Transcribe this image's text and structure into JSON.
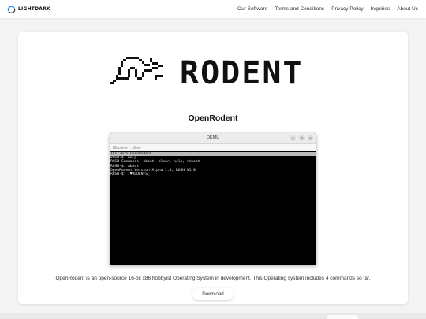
{
  "nav": {
    "brand": "LIGHTDARK",
    "links": [
      {
        "label": "Our Software"
      },
      {
        "label": "Terms and Conditions"
      },
      {
        "label": "Privacy Policy"
      },
      {
        "label": "Inquiries"
      },
      {
        "label": "About Us"
      }
    ]
  },
  "logo": {
    "text": "RODENT"
  },
  "product": {
    "title": "OpenRodent",
    "description": "OpenRodent is an open-source 16-bit x86 hobbyist Operating System in development. This Operating system includes 4 commands so far.",
    "download_label": "Download"
  },
  "qemu": {
    "title": "QEMU",
    "menus": [
      "Machine",
      "View"
    ],
    "controls": [
      "–",
      "⊙",
      "×"
    ],
    "console_lines": [
      "(C) 2025 OpenRodent",
      "ROSH-$: help",
      "ROSH Commands: about, clear, help, reboot",
      "ROSH-$: about",
      "OpenRodent Version Alpha 1.0, ROSH V1.0",
      "ROSH-$: I♥RODENTS_"
    ]
  },
  "colors": {
    "accent": "#1e90ff",
    "text": "#222222",
    "console_bg": "#000000"
  }
}
